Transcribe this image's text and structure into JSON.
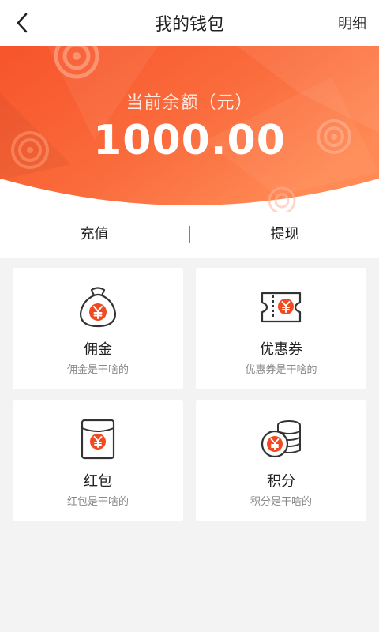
{
  "header": {
    "title": "我的钱包",
    "detail_label": "明细"
  },
  "balance": {
    "label": "当前余额（元）",
    "amount": "1000.00"
  },
  "actions": {
    "recharge_label": "充值",
    "withdraw_label": "提现"
  },
  "cards": [
    {
      "title": "佣金",
      "desc": "佣金是干啥的",
      "icon": "money-bag-icon"
    },
    {
      "title": "优惠券",
      "desc": "优惠券是干啥的",
      "icon": "coupon-icon"
    },
    {
      "title": "红包",
      "desc": "红包是干啥的",
      "icon": "red-envelope-icon"
    },
    {
      "title": "积分",
      "desc": "积分是干啥的",
      "icon": "coins-icon"
    }
  ],
  "colors": {
    "accent": "#ee5a2e",
    "banner_light": "#ff8a5c",
    "banner_dark": "#f4511e"
  }
}
